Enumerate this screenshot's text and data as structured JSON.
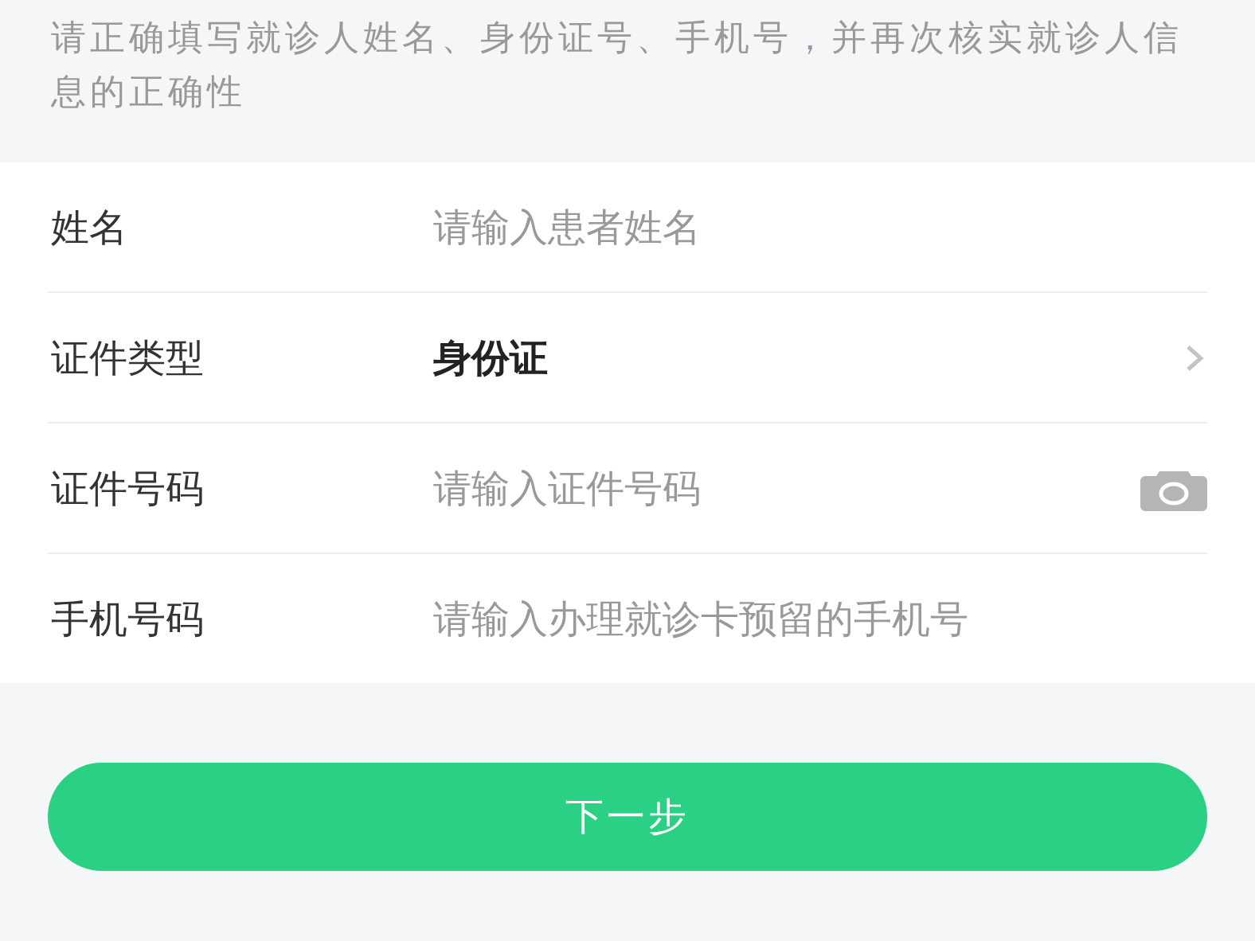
{
  "notice": "请正确填写就诊人姓名、身份证号、手机号，并再次核实就诊人信息的正确性",
  "form": [
    {
      "kind": "text",
      "label": "姓名",
      "placeholder": "请输入患者姓名"
    },
    {
      "kind": "picker",
      "label": "证件类型",
      "value": "身份证"
    },
    {
      "kind": "camera",
      "label": "证件号码",
      "placeholder": "请输入证件号码"
    },
    {
      "kind": "text",
      "label": "手机号码",
      "placeholder": "请输入办理就诊卡预留的手机号"
    }
  ],
  "next_button": "下一步"
}
